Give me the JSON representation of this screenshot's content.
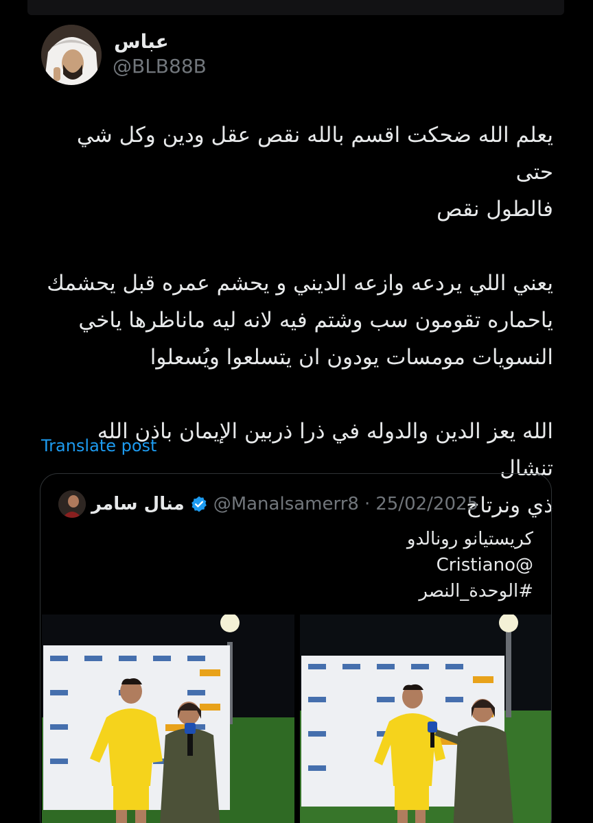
{
  "author": {
    "name": "عباس",
    "handle": "@BLB88B"
  },
  "tweet": {
    "paragraphs": [
      [
        "يعلم الله ضحكت اقسم بالله نقص عقل ودين وكل شي حتى",
        "فالطول نقص"
      ],
      [
        "يعني اللي يردعه وازعه الديني و يحشم عمره قبل يحشمك",
        "ياحماره تقومون سب وشتم فيه لانه ليه ماناظرها ياخي",
        "النسويات مومسات يودون ان يتسلعوا ويُسعلوا"
      ],
      [
        "الله يعز الدين والدوله في ذرا ذربين الإيمان باذن الله تنشال",
        "ذي ونرتاح"
      ]
    ]
  },
  "translate_label": "Translate post",
  "quote": {
    "name": "منال سامر",
    "handle": "@Manalsamerr8",
    "separator": "·",
    "date": "25/02/2025",
    "lines": [
      "كريستيانو رونالدو",
      "@Cristiano",
      "#الوحدة_النصر"
    ]
  },
  "media": [
    {
      "icon": "photo-interview-1"
    },
    {
      "icon": "photo-interview-2"
    }
  ],
  "colors": {
    "background": "#000000",
    "text": "#e7e9ea",
    "muted": "#71767b",
    "link": "#1d9bf0",
    "verified": "#1d9bf0",
    "jersey": "#f5d31c",
    "pitch": "#3c7a2a"
  }
}
